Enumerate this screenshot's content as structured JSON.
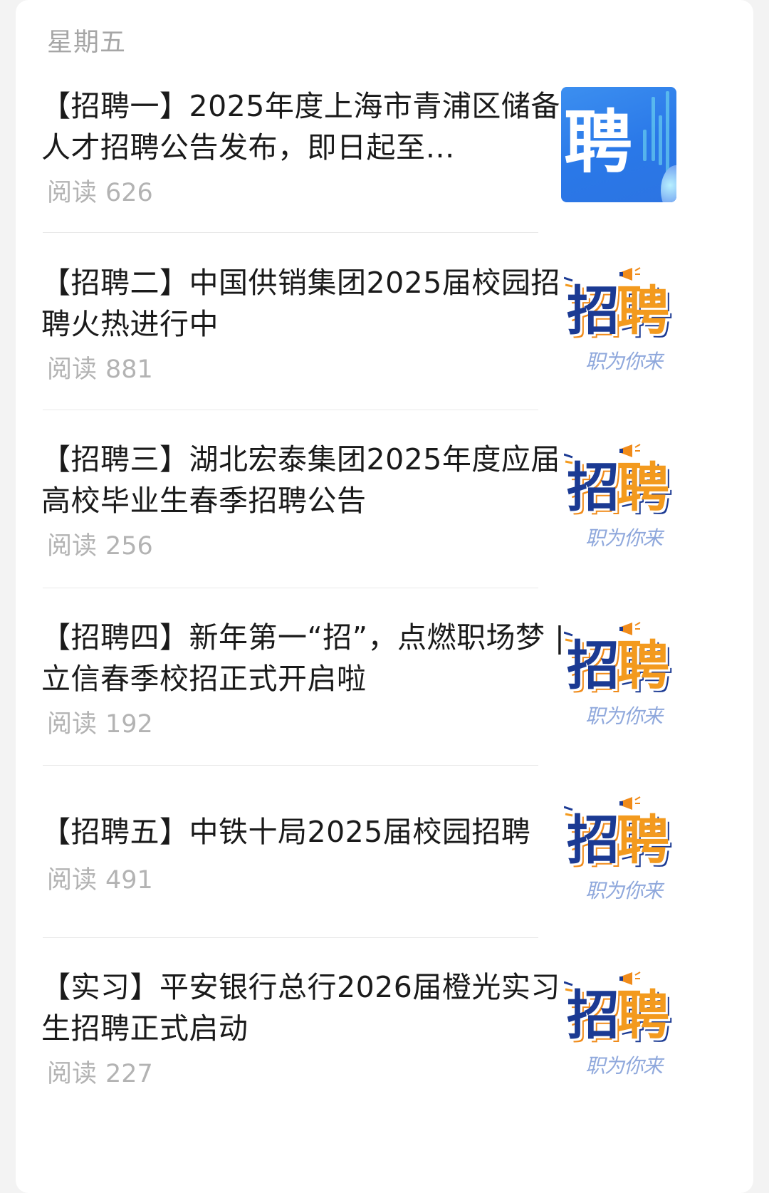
{
  "day_label": "星期五",
  "colors": {
    "title_text": "#1a1a1a",
    "meta_text": "#b3b3b3",
    "day_label_text": "#a6a6a6",
    "card_background": "#ffffff",
    "page_background": "#f3f3f3",
    "logo_navy": "#1b3a93",
    "logo_orange": "#f39a1e",
    "thumb_blue": "#2a78e8"
  },
  "articles": [
    {
      "title": "【招聘一】2025年度上海市青浦区储备人才招聘公告发布，即日起至…",
      "read_label": "阅读",
      "read_count": "626",
      "thumbnail": {
        "style": "blue",
        "text": "聘"
      }
    },
    {
      "title": "【招聘二】中国供销集团2025届校园招聘火热进行中",
      "read_label": "阅读",
      "read_count": "881",
      "thumbnail": {
        "style": "recruit-logo",
        "main": "招聘",
        "main_a": "招",
        "main_b": "聘",
        "sub": "职为你来"
      }
    },
    {
      "title": "【招聘三】湖北宏泰集团2025年度应届高校毕业生春季招聘公告",
      "read_label": "阅读",
      "read_count": "256",
      "thumbnail": {
        "style": "recruit-logo",
        "main": "招聘",
        "main_a": "招",
        "main_b": "聘",
        "sub": "职为你来"
      }
    },
    {
      "title": "【招聘四】新年第一“招”，点燃职场梦 | 立信春季校招正式开启啦",
      "read_label": "阅读",
      "read_count": "192",
      "thumbnail": {
        "style": "recruit-logo",
        "main": "招聘",
        "main_a": "招",
        "main_b": "聘",
        "sub": "职为你来"
      }
    },
    {
      "title": "【招聘五】中铁十局2025届校园招聘",
      "read_label": "阅读",
      "read_count": "491",
      "thumbnail": {
        "style": "recruit-logo",
        "main": "招聘",
        "main_a": "招",
        "main_b": "聘",
        "sub": "职为你来"
      }
    },
    {
      "title": "【实习】平安银行总行2026届橙光实习生招聘正式启动",
      "read_label": "阅读",
      "read_count": "227",
      "thumbnail": {
        "style": "recruit-logo",
        "main": "招聘",
        "main_a": "招",
        "main_b": "聘",
        "sub": "职为你来"
      }
    }
  ]
}
